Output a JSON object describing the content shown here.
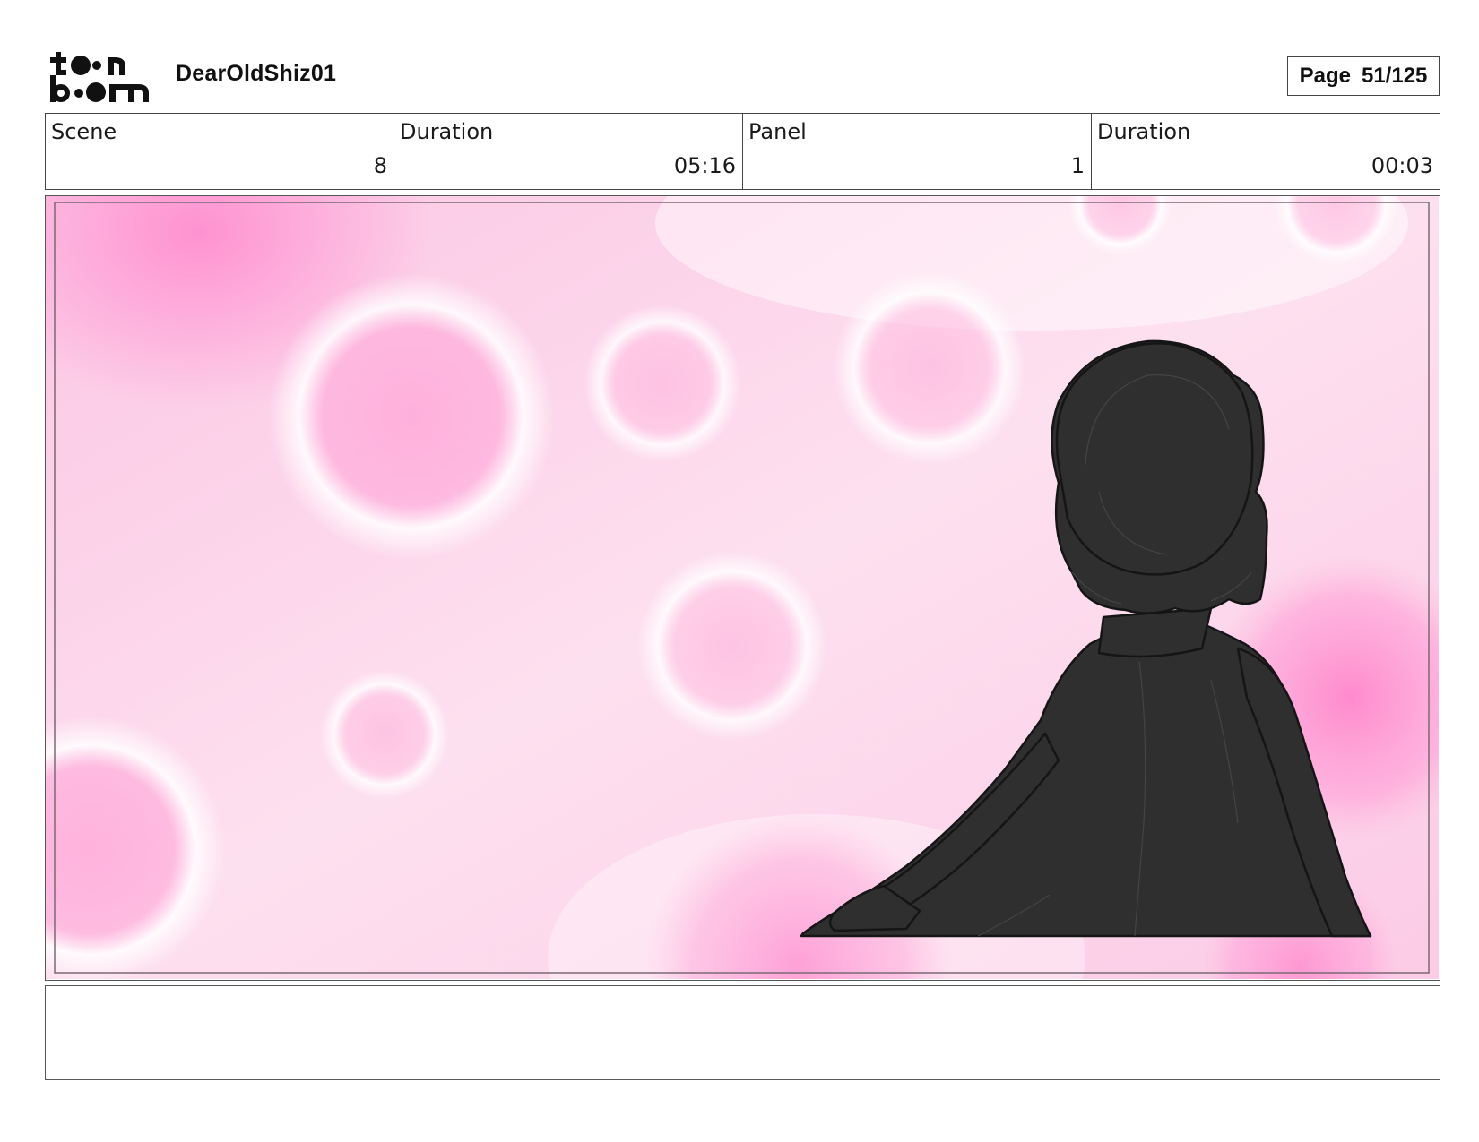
{
  "header": {
    "logo_alt": "toon boom",
    "project_title": "DearOldShiz01",
    "page_label": "Page",
    "page_number": "51/125"
  },
  "info": {
    "scene_label": "Scene",
    "scene_value": "8",
    "scene_duration_label": "Duration",
    "scene_duration_value": "05:16",
    "panel_label": "Panel",
    "panel_value": "1",
    "panel_duration_label": "Duration",
    "panel_duration_value": "00:03"
  },
  "panel": {
    "illustration": "silhouette-of-girl-against-pink-bokeh-background",
    "background_color": "#fbd3e8",
    "accent_color": "#ff8fcf",
    "silhouette_color": "#2f2f2f"
  },
  "notes": {
    "text": ""
  }
}
